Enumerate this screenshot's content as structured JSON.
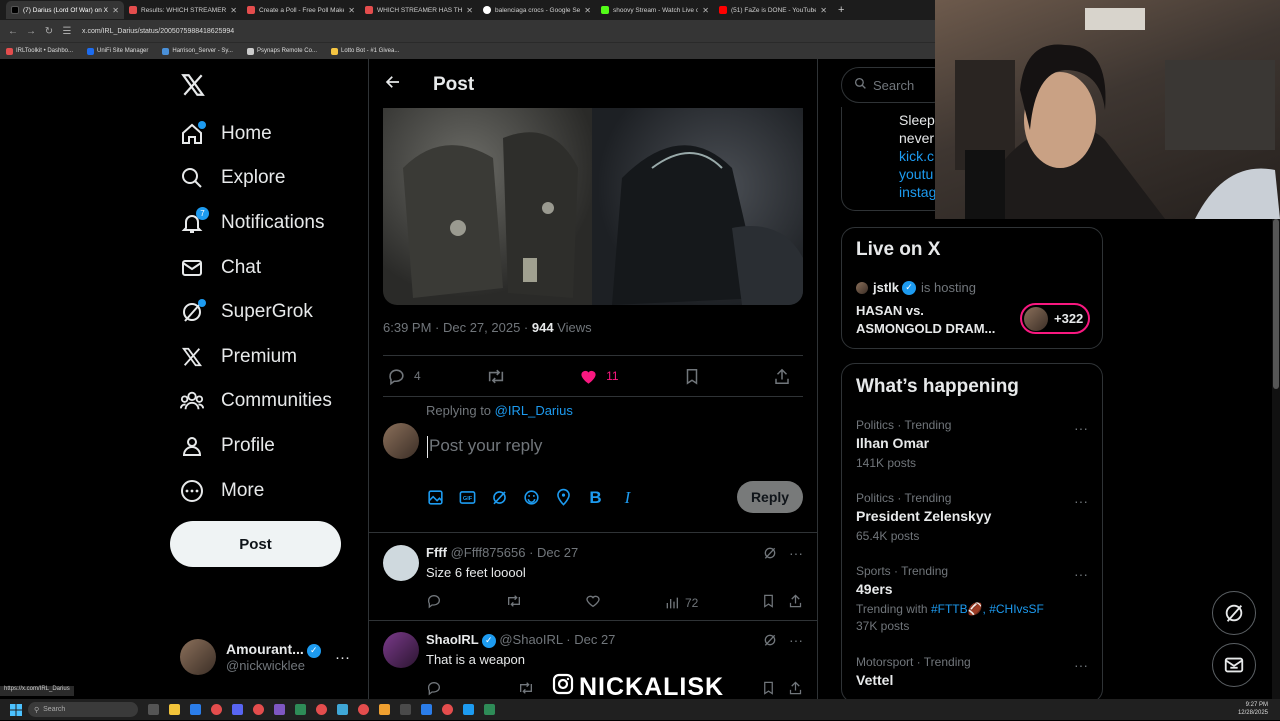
{
  "browser": {
    "tabs": [
      {
        "title": "(7) Darius (Lord Of War) on X: ",
        "color": "#000000",
        "active": true
      },
      {
        "title": "Results: WHICH STREAMER HA",
        "color": "#e44d4d",
        "active": false
      },
      {
        "title": "Create a Poll - Free Poll Maker",
        "color": "#e44d4d",
        "active": false
      },
      {
        "title": "WHICH STREAMER HAS THE BI",
        "color": "#e44d4d",
        "active": false
      },
      {
        "title": "balenciaga crocs - Google Sear",
        "color": "#ffffff",
        "active": false
      },
      {
        "title": "shoovy Stream - Watch Live on",
        "color": "#53fc18",
        "active": false
      },
      {
        "title": "(51) FaZe is DONE - YouTube",
        "color": "#ff0000",
        "active": false
      }
    ],
    "new_tab": "+",
    "url": "x.com/IRL_Darius/status/2005075988418625994",
    "bookmarks": [
      {
        "label": "IRLToolkit • Dashbo...",
        "color": "#e44d4d"
      },
      {
        "label": "UniFi Site Manager",
        "color": "#1d6cf0"
      },
      {
        "label": "Harrison_Server - Sy...",
        "color": "#4a90d9"
      },
      {
        "label": "Psynaps Remote Co...",
        "color": "#cccccc"
      },
      {
        "label": "Lotto Bot - #1 Givea...",
        "color": "#f5c542"
      }
    ],
    "status_url": "https://x.com/IRL_Darius"
  },
  "sidebar": {
    "items": [
      {
        "label": "Home",
        "icon": "home-icon"
      },
      {
        "label": "Explore",
        "icon": "search-icon"
      },
      {
        "label": "Notifications",
        "icon": "bell-icon",
        "badge": "7"
      },
      {
        "label": "Chat",
        "icon": "mail-icon"
      },
      {
        "label": "SuperGrok",
        "icon": "grok-icon"
      },
      {
        "label": "Premium",
        "icon": "x-logo-icon"
      },
      {
        "label": "Communities",
        "icon": "communities-icon"
      },
      {
        "label": "Profile",
        "icon": "profile-icon"
      },
      {
        "label": "More",
        "icon": "more-icon"
      }
    ],
    "post_button": "Post",
    "account": {
      "name": "Amourant...",
      "handle": "@nickwicklee",
      "more": "···"
    }
  },
  "post": {
    "header": "Post",
    "time": "6:39 PM · Dec 27, 2025 · ",
    "views_count": "944",
    "views_label": " Views",
    "replies": "4",
    "likes": "11",
    "accent": "#f91880"
  },
  "compose": {
    "replying_prefix": "Replying to ",
    "replying_handle": "@IRL_Darius",
    "placeholder": "Post your reply",
    "reply_button": "Reply",
    "bold": "B",
    "italic": "I"
  },
  "replies": [
    {
      "name": "Ffff",
      "handle": "@Ffff875656",
      "date": " · Dec 27",
      "text": "Size 6 feet looool",
      "views": "72",
      "verified": false
    },
    {
      "name": "ShaoIRL",
      "handle": "@ShaoIRL",
      "date": " · Dec 27",
      "text": "That is a weapon",
      "views": "",
      "verified": true
    }
  ],
  "right": {
    "search_placeholder": "Search",
    "profile_lines": [
      "Sleep",
      "never",
      "kick.c",
      "youtu",
      "instag"
    ],
    "live": {
      "title": "Live on X",
      "host": "jstlk",
      "hosting": "is hosting",
      "stream_title": "HASAN vs. ASMONGOLD DRAM...",
      "listeners": "+322"
    },
    "trending": {
      "title": "What’s happening",
      "items": [
        {
          "category": "Politics · Trending",
          "title": "Ilhan Omar",
          "count": "141K posts"
        },
        {
          "category": "Politics · Trending",
          "title": "President Zelenskyy",
          "count": "65.4K posts"
        },
        {
          "category": "Sports · Trending",
          "title": "49ers",
          "with_prefix": "Trending with ",
          "with_tags": "#FTTB🏈, #CHIvsSF",
          "count": "37K posts"
        },
        {
          "category": "Motorsport · Trending",
          "title": "Vettel",
          "count": ""
        }
      ]
    }
  },
  "overlay": {
    "watermark": "NICKALISK"
  },
  "taskbar": {
    "search": "Search",
    "time": "9:27 PM",
    "date": "12/28/2025"
  }
}
